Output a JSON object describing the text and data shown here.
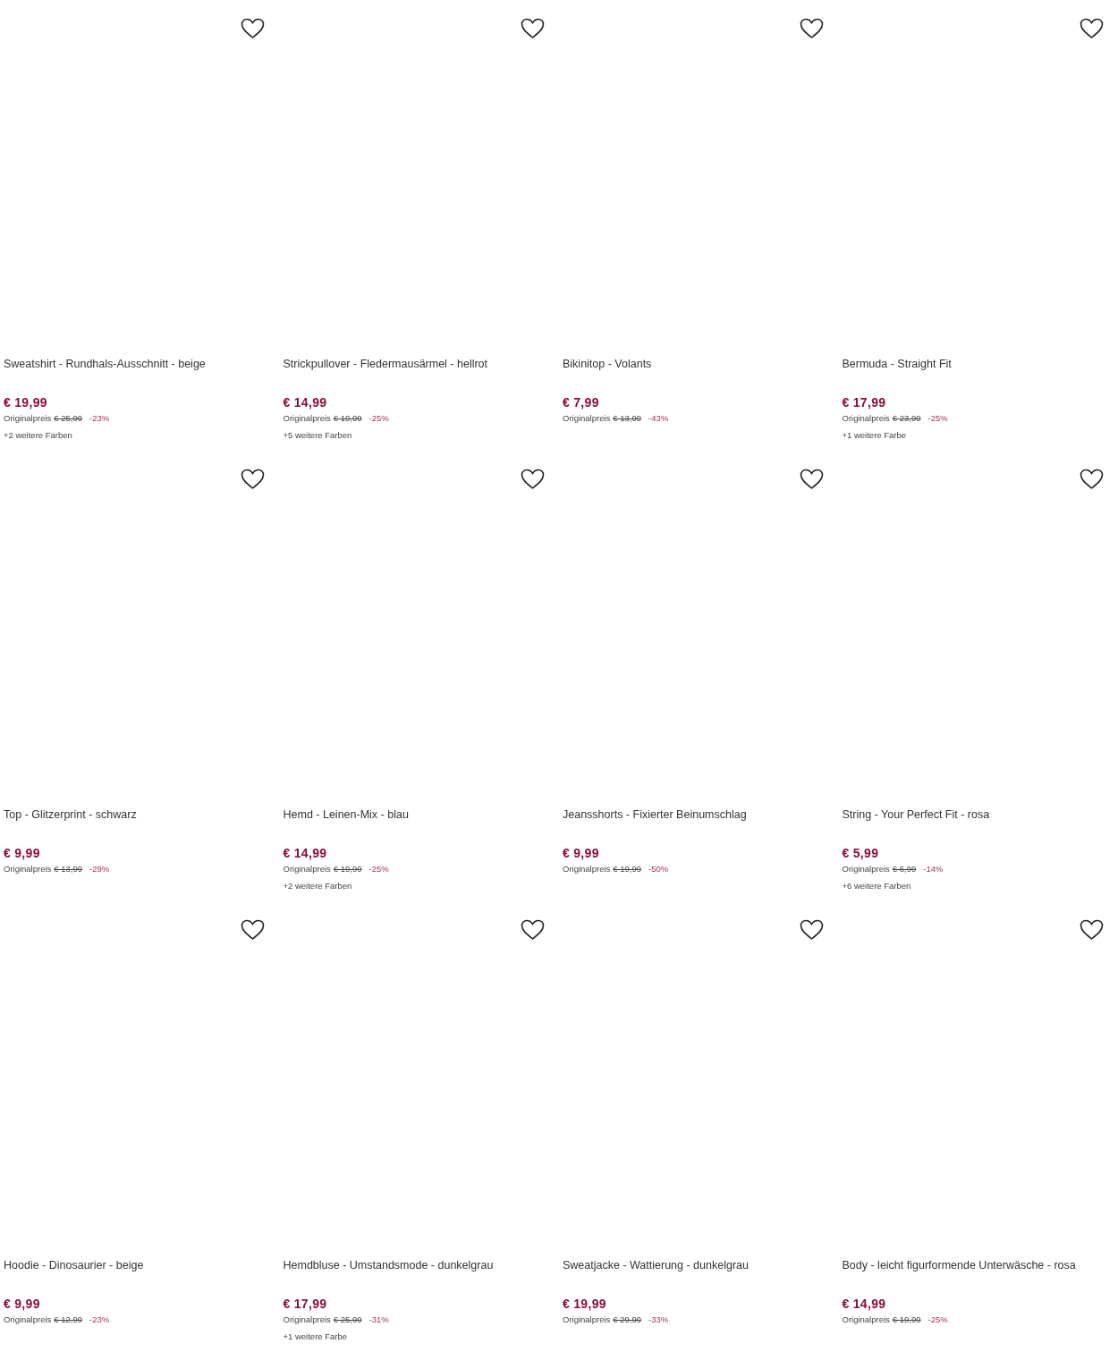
{
  "products": [
    {
      "title": "Sweatshirt - Rundhals-Ausschnitt - beige",
      "price": "€ 19,99",
      "original_label": "Originalpreis",
      "original_price": "€ 25,99",
      "discount": "-23%",
      "more_colors": "+2 weitere Farben"
    },
    {
      "title": "Strickpullover - Fledermausärmel - hellrot",
      "price": "€ 14,99",
      "original_label": "Originalpreis",
      "original_price": "€ 19,99",
      "discount": "-25%",
      "more_colors": "+5 weitere Farben"
    },
    {
      "title": "Bikinitop - Volants",
      "price": "€ 7,99",
      "original_label": "Originalpreis",
      "original_price": "€ 13,99",
      "discount": "-43%"
    },
    {
      "title": "Bermuda - Straight Fit",
      "price": "€ 17,99",
      "original_label": "Originalpreis",
      "original_price": "€ 23,99",
      "discount": "-25%",
      "more_colors": "+1 weitere Farbe"
    },
    {
      "title": "Top - Glitzerprint - schwarz",
      "price": "€ 9,99",
      "original_label": "Originalpreis",
      "original_price": "€ 13,99",
      "discount": "-29%"
    },
    {
      "title": "Hemd - Leinen-Mix - blau",
      "price": "€ 14,99",
      "original_label": "Originalpreis",
      "original_price": "€ 19,99",
      "discount": "-25%",
      "more_colors": "+2 weitere Farben"
    },
    {
      "title": "Jeansshorts - Fixierter Beinumschlag",
      "price": "€ 9,99",
      "original_label": "Originalpreis",
      "original_price": "€ 19,99",
      "discount": "-50%"
    },
    {
      "title": "String - Your Perfect Fit - rosa",
      "price": "€ 5,99",
      "original_label": "Originalpreis",
      "original_price": "€ 6,99",
      "discount": "-14%",
      "more_colors": "+6 weitere Farben"
    },
    {
      "title": "Hoodie - Dinosaurier - beige",
      "price": "€ 9,99",
      "original_label": "Originalpreis",
      "original_price": "€ 12,99",
      "discount": "-23%"
    },
    {
      "title": "Hemdbluse - Umstandsmode - dunkelgrau",
      "price": "€ 17,99",
      "original_label": "Originalpreis",
      "original_price": "€ 25,99",
      "discount": "-31%",
      "more_colors": "+1 weitere Farbe"
    },
    {
      "title": "Sweatjacke - Wattierung - dunkelgrau",
      "price": "€ 19,99",
      "original_label": "Originalpreis",
      "original_price": "€ 29,99",
      "discount": "-33%"
    },
    {
      "title": "Body - leicht figurformende Unterwäsche - rosa",
      "price": "€ 14,99",
      "original_label": "Originalpreis",
      "original_price": "€ 19,99",
      "discount": "-25%"
    }
  ]
}
